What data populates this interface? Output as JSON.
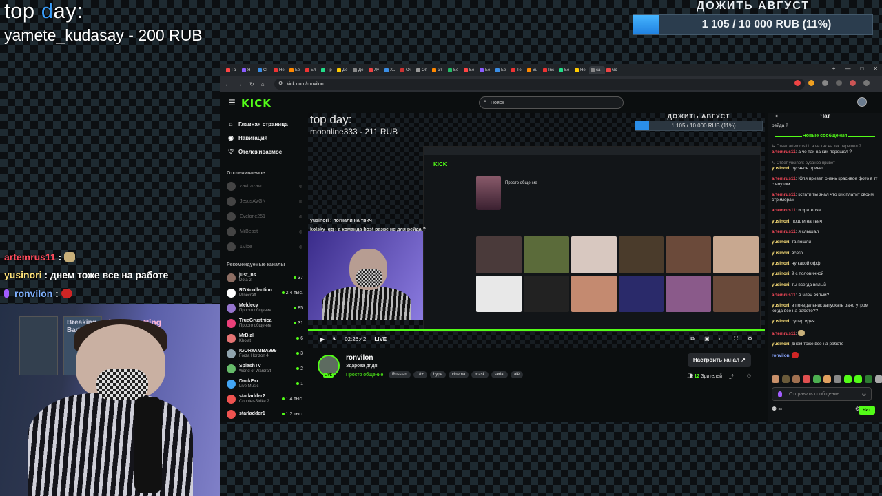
{
  "overlay": {
    "top_title": "top day:",
    "top_title_highlight": "d",
    "top_donor": "yamete_kudasay - 200 RUB",
    "goal": {
      "title": "ДОЖИТЬ АВГУСТ",
      "text": "1 105 / 10 000 RUB (11%)",
      "progress": 0.11
    },
    "chat": [
      {
        "user": "artemrus11",
        "sep": " : ",
        "text": "",
        "color": "#ff4b5c"
      },
      {
        "user": "yusinori",
        "sep": " : ",
        "text": "днем тоже все на работе",
        "color": "#ffe37a"
      },
      {
        "user": "ronvilon",
        "sep": " : ",
        "text": "",
        "color": "#7eb0ff"
      }
    ],
    "webcam_posters": [
      "Breaking Bad",
      "Trainspotting"
    ]
  },
  "browser": {
    "tabs": [
      "Га",
      "Я",
      "Сl",
      "Не",
      "Бе",
      "Бл",
      "Пр",
      "Де",
      "Де",
      "Лу",
      "Хь",
      "Оч",
      "Оп",
      "Эт",
      "Бе",
      "Бе",
      "Бе",
      "Бе",
      "Те",
      "Вь",
      "Inc",
      "Бе",
      "Не",
      "са",
      "Gc"
    ],
    "url": "kick.com/ronvilon",
    "window_controls": [
      "+",
      "—",
      "□",
      "✕"
    ]
  },
  "kick": {
    "logo": "KICK",
    "search_placeholder": "Поиск",
    "nav": [
      {
        "icon": "home",
        "label": "Главная страница"
      },
      {
        "icon": "compass",
        "label": "Навигация"
      },
      {
        "icon": "heart",
        "label": "Отслеживаемое"
      }
    ],
    "following_title": "Отслеживаемое",
    "following": [
      "zavtrazavr",
      "JesusAVGN",
      "Evelone251",
      "MrBeast",
      "1Vibe"
    ],
    "recommended_title": "Рекомендуемые каналы",
    "recommended": [
      {
        "name": "just_ns",
        "game": "Dota 2",
        "viewers": "37",
        "color": "#8d6e63"
      },
      {
        "name": "RGXcollection",
        "game": "Minecraft",
        "viewers": "2,4 тыс.",
        "color": "#ffffff"
      },
      {
        "name": "Meldecy",
        "game": "Просто общение",
        "viewers": "85",
        "color": "#9575cd"
      },
      {
        "name": "TrueGrustnica",
        "game": "Просто общение",
        "viewers": "31",
        "color": "#ec407a"
      },
      {
        "name": "MrBizl",
        "game": "Kholat",
        "viewers": "6",
        "color": "#e57373"
      },
      {
        "name": "IGORYAMBA999",
        "game": "Forza Horizon 4",
        "viewers": "3",
        "color": "#90a4ae"
      },
      {
        "name": "SplashTV",
        "game": "World of Warcraft",
        "viewers": "2",
        "color": "#66bb6a"
      },
      {
        "name": "DackFax",
        "game": "Live Music",
        "viewers": "1",
        "color": "#42a5f5"
      },
      {
        "name": "starladder2",
        "game": "Counter-Strike 2",
        "viewers": "1,4 тыс.",
        "color": "#ef5350"
      },
      {
        "name": "starladder1",
        "game": "",
        "viewers": "1,2 тыс.",
        "color": "#ef5350"
      }
    ],
    "player": {
      "top_title": "top day:",
      "top_donor": "moonline333 - 211 RUB",
      "goal_title": "ДОЖИТЬ АВГУСТ",
      "goal_text": "1 105 / 10 000 RUB (11%)",
      "goal_progress": 0.11,
      "nested_chat": [
        {
          "text": "yusinori : погнали на твич"
        },
        {
          "text": "kolsky_qq : а команда host разве не для рейда ?"
        }
      ],
      "time": "02:26:42",
      "live": "LIVE",
      "nested_stream_title": "Просто общение"
    },
    "channel": {
      "name": "ronvilon",
      "title": "Здарова дядя!",
      "category": "Просто общение",
      "tags": [
        "Russian",
        "18+",
        "hype",
        "cinema",
        "mask",
        "serial",
        "alё"
      ],
      "live_badge": "LIVE",
      "settings_button": "Настроить канал",
      "viewers_count": "12",
      "viewers_label": "Зрителей"
    },
    "chat": {
      "title": "Чат",
      "new_messages": "Новые сообщения",
      "input_placeholder": "Отправить сообщение",
      "send_button": "Чат",
      "footer_left": "∞",
      "messages": [
        {
          "user": "",
          "text": "рейда ?",
          "color": "#ddd"
        },
        {
          "user": "artemrus11",
          "text": "а че так на кик перешел ?",
          "color": "#ff4b5c",
          "reply": "Ответ artemrus11: а че так на кик перешел ?"
        },
        {
          "user": "yusinori",
          "text": "русанов привет",
          "color": "#ffe37a",
          "reply": "Ответ yusinori: русанов привет"
        },
        {
          "user": "artemrus11",
          "text": "Юля привет, очень красивое фото в тг с ноутом",
          "color": "#ff4b5c"
        },
        {
          "user": "artemrus11",
          "text": "кстати ты знал что кик платит своим стримерам",
          "color": "#ff4b5c"
        },
        {
          "user": "artemrus11",
          "text": "и зрителям",
          "color": "#ff4b5c"
        },
        {
          "user": "yusinori",
          "text": "пошли на твич",
          "color": "#ffe37a"
        },
        {
          "user": "artemrus11",
          "text": "я слышал",
          "color": "#ff4b5c"
        },
        {
          "user": "yusinori",
          "text": "та пошли",
          "color": "#ffe37a"
        },
        {
          "user": "yusinori",
          "text": "всего",
          "color": "#ffe37a"
        },
        {
          "user": "yusinori",
          "text": "ну какой офф",
          "color": "#ffe37a"
        },
        {
          "user": "yusinori",
          "text": "9 с половинной",
          "color": "#ffe37a"
        },
        {
          "user": "yusinori",
          "text": "ты всегда вялый",
          "color": "#ffe37a"
        },
        {
          "user": "artemrus11",
          "text": "А член вялый?",
          "color": "#ff4b5c"
        },
        {
          "user": "yusinori",
          "text": "в понедельник запускать рано утром когда все на работе??",
          "color": "#ffe37a"
        },
        {
          "user": "yusinori",
          "text": "супер идея",
          "color": "#ffe37a"
        },
        {
          "user": "artemrus11",
          "text": "",
          "color": "#ff4b5c"
        },
        {
          "user": "yusinori",
          "text": "днем тоже все на работе",
          "color": "#ffe37a"
        },
        {
          "user": "ronvilon",
          "text": "",
          "color": "#8aa6ff"
        }
      ]
    }
  }
}
